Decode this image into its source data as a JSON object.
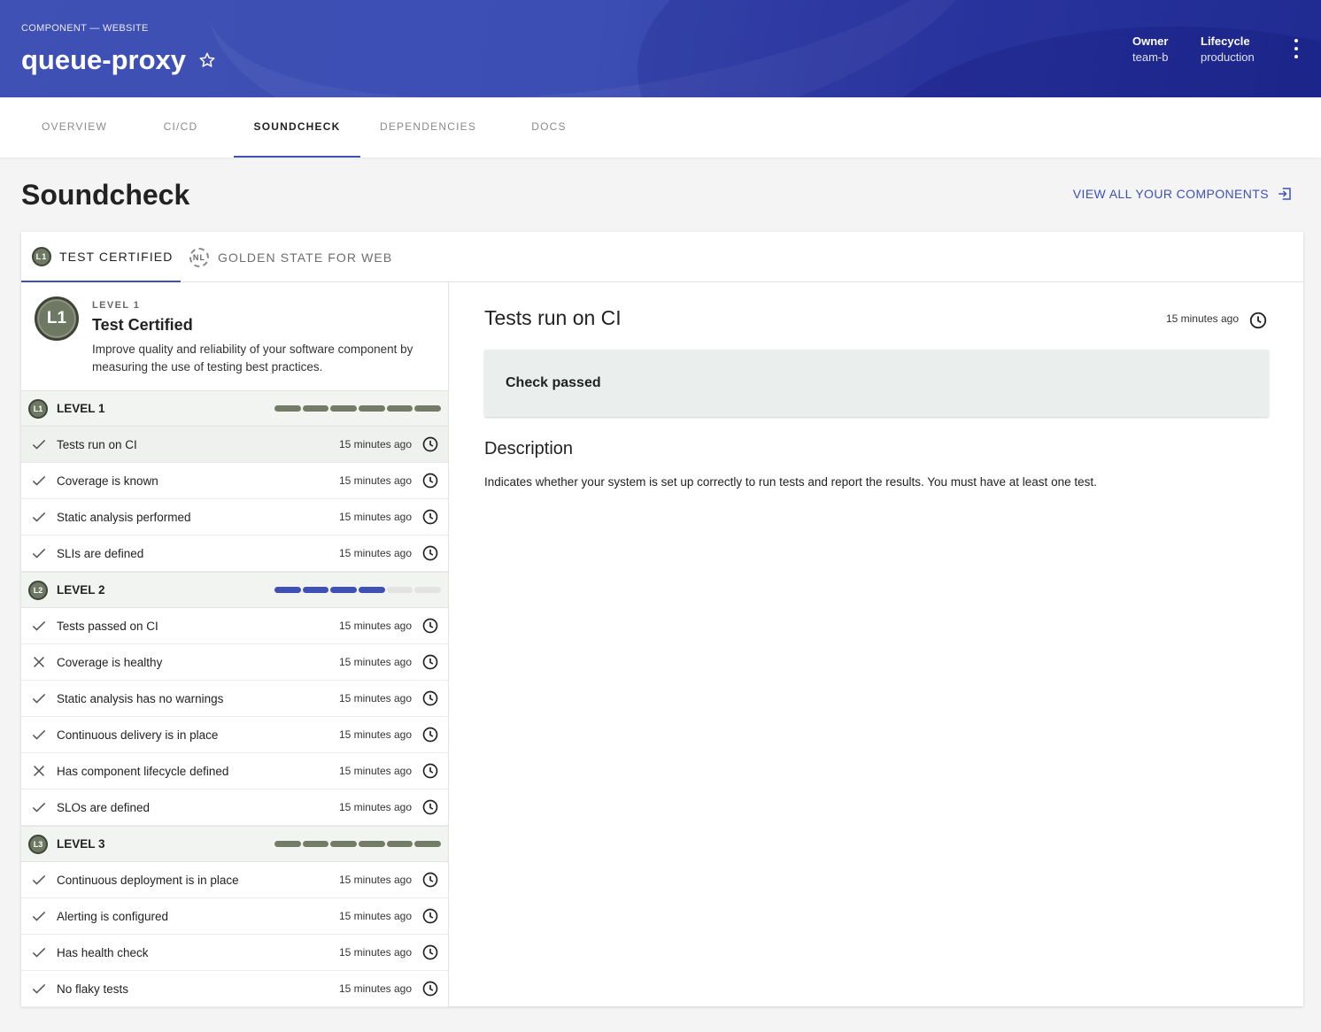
{
  "header": {
    "breadcrumb": "COMPONENT — WEBSITE",
    "title": "queue-proxy",
    "owner_label": "Owner",
    "owner_value": "team-b",
    "lifecycle_label": "Lifecycle",
    "lifecycle_value": "production",
    "star_icon": "star-outline-icon",
    "menu_icon": "more-vert-icon"
  },
  "tabs": [
    {
      "label": "OVERVIEW"
    },
    {
      "label": "CI/CD"
    },
    {
      "label": "SOUNDCHECK",
      "active": true
    },
    {
      "label": "DEPENDENCIES"
    },
    {
      "label": "DOCS"
    }
  ],
  "page": {
    "title": "Soundcheck",
    "view_all": "VIEW ALL YOUR COMPONENTS"
  },
  "tracks": [
    {
      "badge": "L1",
      "label": "TEST CERTIFIED",
      "active": true
    },
    {
      "badge": "NL",
      "label": "GOLDEN STATE FOR WEB",
      "active": false
    }
  ],
  "intro": {
    "badge": "L1",
    "kicker": "LEVEL 1",
    "title": "Test Certified",
    "description": "Improve quality and reliability of your software component by measuring the use of testing best practices."
  },
  "levels": [
    {
      "badge": "L1",
      "label": "LEVEL 1",
      "progress": 1.0,
      "checks": [
        {
          "name": "Tests run on CI",
          "status": "pass",
          "time": "15 minutes ago",
          "selected": true
        },
        {
          "name": "Coverage is known",
          "status": "pass",
          "time": "15 minutes ago"
        },
        {
          "name": "Static analysis performed",
          "status": "pass",
          "time": "15 minutes ago"
        },
        {
          "name": "SLIs are defined",
          "status": "pass",
          "time": "15 minutes ago"
        }
      ]
    },
    {
      "badge": "L2",
      "label": "LEVEL 2",
      "progress": 0.67,
      "checks": [
        {
          "name": "Tests passed on CI",
          "status": "pass",
          "time": "15 minutes ago"
        },
        {
          "name": "Coverage is healthy",
          "status": "fail",
          "time": "15 minutes ago"
        },
        {
          "name": "Static analysis has no warnings",
          "status": "pass",
          "time": "15 minutes ago"
        },
        {
          "name": "Continuous delivery is in place",
          "status": "pass",
          "time": "15 minutes ago"
        },
        {
          "name": "Has component lifecycle defined",
          "status": "fail",
          "time": "15 minutes ago"
        },
        {
          "name": "SLOs are defined",
          "status": "pass",
          "time": "15 minutes ago"
        }
      ]
    },
    {
      "badge": "L3",
      "label": "LEVEL 3",
      "progress": 1.0,
      "checks": [
        {
          "name": "Continuous deployment is in place",
          "status": "pass",
          "time": "15 minutes ago"
        },
        {
          "name": "Alerting is configured",
          "status": "pass",
          "time": "15 minutes ago"
        },
        {
          "name": "Has health check",
          "status": "pass",
          "time": "15 minutes ago"
        },
        {
          "name": "No flaky tests",
          "status": "pass",
          "time": "15 minutes ago"
        }
      ]
    }
  ],
  "detail": {
    "title": "Tests run on CI",
    "time": "15 minutes ago",
    "result": "Check passed",
    "description_heading": "Description",
    "description": "Indicates whether your system is set up correctly to run tests and report the results. You must have at least one test."
  },
  "colors": {
    "accent": "#3f51b5",
    "level_badge": "#6f7863",
    "progress_complete": "#737c66",
    "progress_partial": "#3f51b5"
  }
}
